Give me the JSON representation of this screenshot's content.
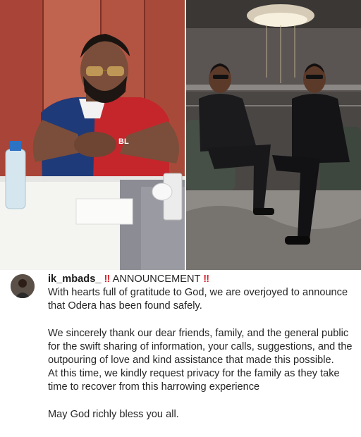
{
  "post": {
    "username": "ik_mbads_",
    "alert_icon": "double-exclamation-icon",
    "heading": "ANNOUNCEMENT",
    "heading_color": "#d8262d",
    "paragraphs": [
      "With hearts full of gratitude to God, we are overjoyed to announce that Odera has been found safely.",
      "We sincerely thank our dear friends, family, and the general public for the swift sharing of information, your calls, suggestions, and the outpouring of love and kind assistance that made this possible.",
      "At this time, we kindly request privacy for the family as they take time to recover from this harrowing experience",
      "May God richly bless you all."
    ],
    "alert_symbol": "‼"
  },
  "images": {
    "left_photo": "man-seated-at-table-photo",
    "shirt_text": "BL",
    "right_photo": "two-men-seated-in-lounge-photo"
  }
}
